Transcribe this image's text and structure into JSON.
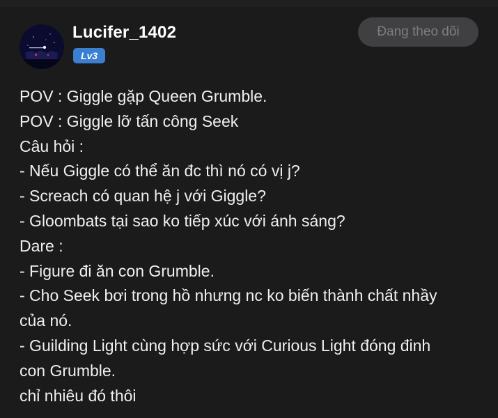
{
  "user": {
    "name": "Lucifer_1402",
    "level": "Lv3"
  },
  "follow_button": {
    "label": "Đang theo dõi"
  },
  "icons": {
    "avatar": "night-sky-avatar-icon"
  },
  "colors": {
    "background": "#1b1b1c",
    "level_badge": "#3a7fd0",
    "follow_button_bg": "#404042",
    "follow_button_text": "#7d7d80"
  },
  "post": {
    "lines": [
      "POV : Giggle gặp Queen Grumble.",
      "POV : Giggle lỡ tấn công Seek",
      "Câu hỏi :",
      "- Nếu Giggle có thể ăn đc thì nó có vị j?",
      "- Screach có quan hệ j với Giggle?",
      "- Gloombats tại sao ko tiếp xúc với ánh sáng?",
      "Dare :",
      "- Figure đi ăn con Grumble.",
      "- Cho Seek bơi trong hồ nhưng nc ko biến thành chất nhầy",
      "của nó.",
      "- Guilding Light cùng hợp sức với Curious Light đóng đinh",
      "con Grumble.",
      "chỉ nhiêu đó thôi"
    ]
  }
}
